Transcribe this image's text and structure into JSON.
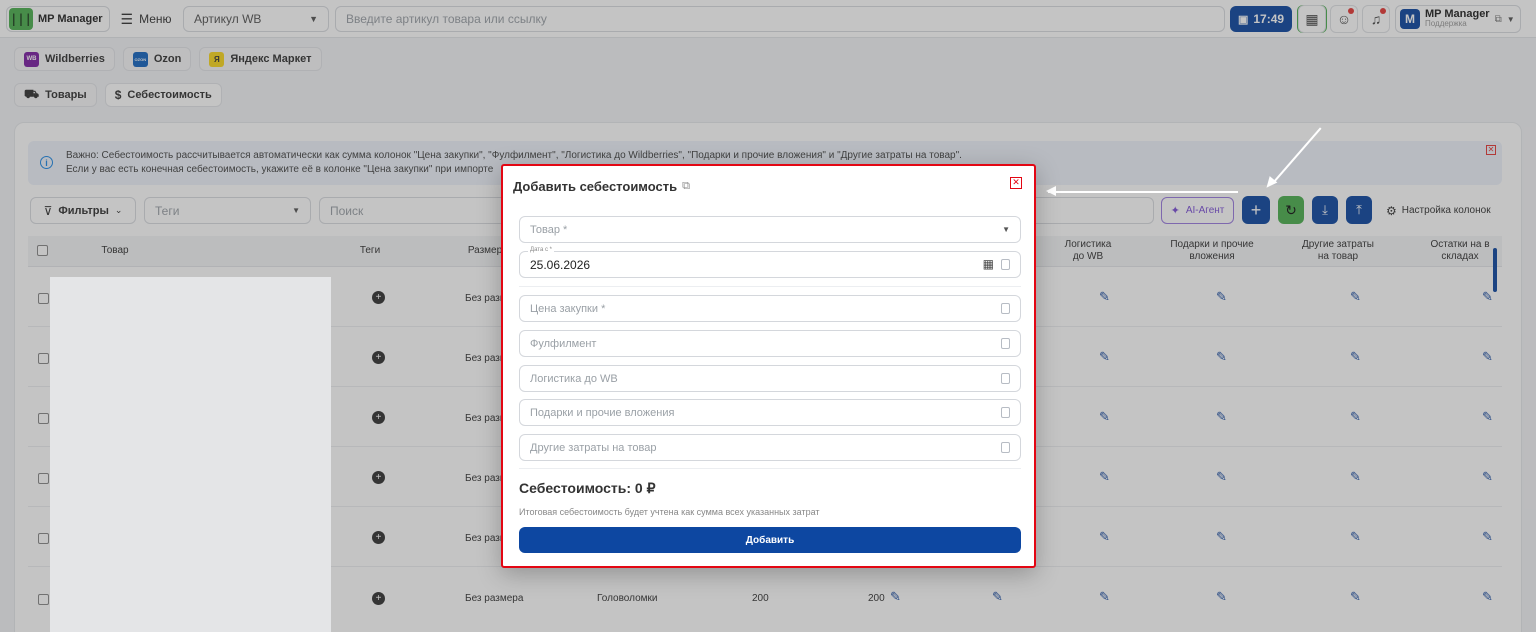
{
  "topbar": {
    "logo_text": "MP Manager",
    "logo_glyph": "|||",
    "menu_label": "Меню",
    "article_select": "Артикул WB",
    "search_placeholder": "Введите артикул товара или ссылку",
    "time": "17:49",
    "account_name": "MP Manager",
    "account_sub": "Поддержка",
    "account_initial": "M"
  },
  "marketplaces": [
    {
      "label": "Wildberries",
      "badge": "WB",
      "color": "#7b1fa2"
    },
    {
      "label": "Ozon",
      "badge": "OZON",
      "color": "#1565c0"
    },
    {
      "label": "Яндекс Маркет",
      "badge": "Я",
      "color": "#f9d71c"
    }
  ],
  "subtabs": {
    "goods": "Товары",
    "cost": "Себестоимость"
  },
  "notice": {
    "line1": "Важно: Себестоимость рассчитывается автоматически как сумма колонок \"Цена закупки\", \"Фулфилмент\", \"Логистика до Wildberries\", \"Подарки и прочие вложения\" и \"Другие затраты на товар\".",
    "line2": "Если у вас есть конечная себестоимость, укажите её в колонке \"Цена закупки\" при импорте"
  },
  "toolbar": {
    "filters": "Фильтры",
    "tags_placeholder": "Теги",
    "search_placeholder": "Поиск",
    "ai_agent": "AI-Агент",
    "columns_settings": "Настройка колонок"
  },
  "table": {
    "headers": {
      "product": "Товар",
      "tags": "Теги",
      "size": "Размер",
      "logistics": "Логистика до WB",
      "gifts": "Подарки и прочие вложения",
      "other": "Другие затраты на товар",
      "stock": "Остатки на в складах"
    },
    "size_value": "Без размера",
    "last_row": {
      "size": "Без размера",
      "category": "Головоломки",
      "price": "200",
      "cost": "200"
    }
  },
  "dialog": {
    "title": "Добавить себестоимость",
    "product_placeholder": "Товар *",
    "date_label": "Дата с *",
    "date_value": "25.06.2026",
    "purchase_price": "Цена закупки *",
    "fulfillment": "Фулфилмент",
    "logistics": "Логистика до WB",
    "gifts": "Подарки и прочие вложения",
    "other_costs": "Другие затраты на товар",
    "total": "Себестоимость: 0 ₽",
    "hint": "Итоговая себестоимость будет учтена как сумма всех указанных затрат",
    "submit": "Добавить"
  },
  "colors": {
    "primary": "#0d47a1",
    "accent_green": "#4caf50",
    "highlight_red": "#e30613"
  }
}
